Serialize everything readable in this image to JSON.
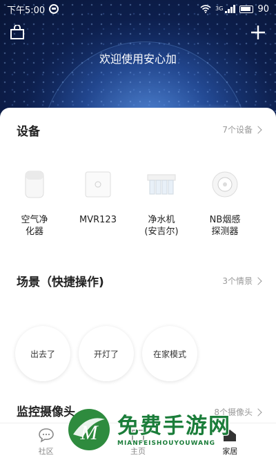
{
  "status_bar": {
    "time": "下午5:00",
    "network": "3G",
    "battery": "90"
  },
  "header": {
    "welcome": "欢迎使用安心加"
  },
  "devices_section": {
    "title": "设备",
    "more": "7个设备",
    "items": [
      {
        "label": "空气净\n化器",
        "icon": "air-purifier-icon"
      },
      {
        "label": "MVR123",
        "icon": "router-box-icon"
      },
      {
        "label": "净水机\n(安吉尔)",
        "icon": "water-purifier-icon"
      },
      {
        "label": "NB烟感\n探测器",
        "icon": "smoke-detector-icon"
      }
    ]
  },
  "scenes_section": {
    "title": "场景（快捷操作)",
    "more": "3个情景",
    "items": [
      "出去了",
      "开灯了",
      "在家模式"
    ]
  },
  "cameras_section": {
    "title": "监控摄像头",
    "more": "8个摄像头"
  },
  "bottom_nav": {
    "items": [
      {
        "label": "社区",
        "icon": "chat-bubble-icon"
      },
      {
        "label": "主页",
        "icon": "home-icon"
      },
      {
        "label": "家居",
        "icon": "house-icon"
      }
    ]
  },
  "watermark": {
    "text": "免费手游网",
    "subtext": "MIANFEISHOUYOUWANG"
  }
}
